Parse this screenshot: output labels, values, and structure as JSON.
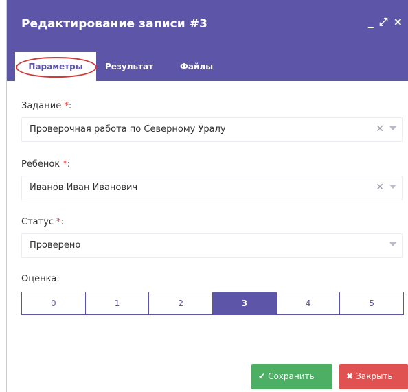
{
  "dialog": {
    "title": "Редактирование записи #3",
    "controls": {
      "minimize": "_",
      "expand": "⤢",
      "close": "×"
    }
  },
  "tabs": [
    {
      "label": "Параметры",
      "active": true
    },
    {
      "label": "Результат",
      "active": false
    },
    {
      "label": "Файлы",
      "active": false
    }
  ],
  "form": {
    "task": {
      "label": "Задание",
      "required_mark": "*",
      "colon": ":",
      "value": "Проверочная работа по Северному Уралу"
    },
    "child": {
      "label": "Ребенок",
      "required_mark": "*",
      "colon": ":",
      "value": "Иванов Иван Иванович"
    },
    "status": {
      "label": "Статус",
      "required_mark": "*",
      "colon": ":",
      "value": "Проверено"
    },
    "grade": {
      "label": "Оценка:",
      "options": [
        "0",
        "1",
        "2",
        "3",
        "4",
        "5"
      ],
      "selected": "3"
    }
  },
  "buttons": {
    "save": {
      "icon": "✔",
      "label": "Сохранить"
    },
    "close": {
      "icon": "✖",
      "label": "Закрыть"
    }
  },
  "colors": {
    "accent": "#5c55a8",
    "required": "#e23b3b",
    "save": "#4caf63",
    "close": "#e05252",
    "highlight": "#d03a3a"
  }
}
